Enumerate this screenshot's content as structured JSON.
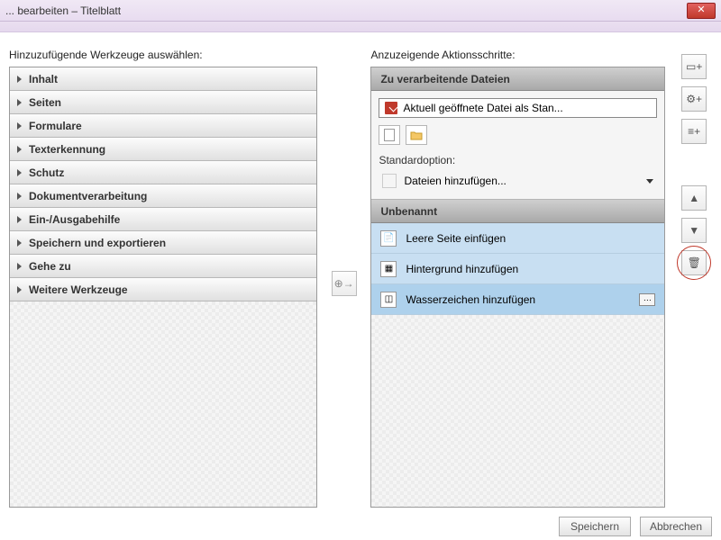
{
  "window": {
    "title": "... bearbeiten – Titelblatt"
  },
  "labels": {
    "left_heading": "Hinzuzufügende Werkzeuge auswählen:",
    "right_heading": "Anzuzeigende Aktionsschritte:"
  },
  "accordion": {
    "items": [
      {
        "label": "Inhalt"
      },
      {
        "label": "Seiten"
      },
      {
        "label": "Formulare"
      },
      {
        "label": "Texterkennung"
      },
      {
        "label": "Schutz"
      },
      {
        "label": "Dokumentverarbeitung"
      },
      {
        "label": "Ein-/Ausgabehilfe"
      },
      {
        "label": "Speichern und exportieren"
      },
      {
        "label": "Gehe zu"
      },
      {
        "label": "Weitere Werkzeuge"
      }
    ]
  },
  "right_panel": {
    "files_header": "Zu verarbeitende Dateien",
    "default_file": "Aktuell geöffnete Datei als Stan...",
    "std_label": "Standardoption:",
    "std_value": "Dateien hinzufügen...",
    "group_header": "Unbenannt",
    "steps": [
      {
        "label": "Leere Seite einfügen"
      },
      {
        "label": "Hintergrund hinzufügen"
      },
      {
        "label": "Wasserzeichen hinzufügen"
      }
    ]
  },
  "footer": {
    "save": "Speichern",
    "cancel": "Abbrechen"
  },
  "colors": {
    "accent_blue": "#aed1ec",
    "hatch": "#ececec"
  }
}
